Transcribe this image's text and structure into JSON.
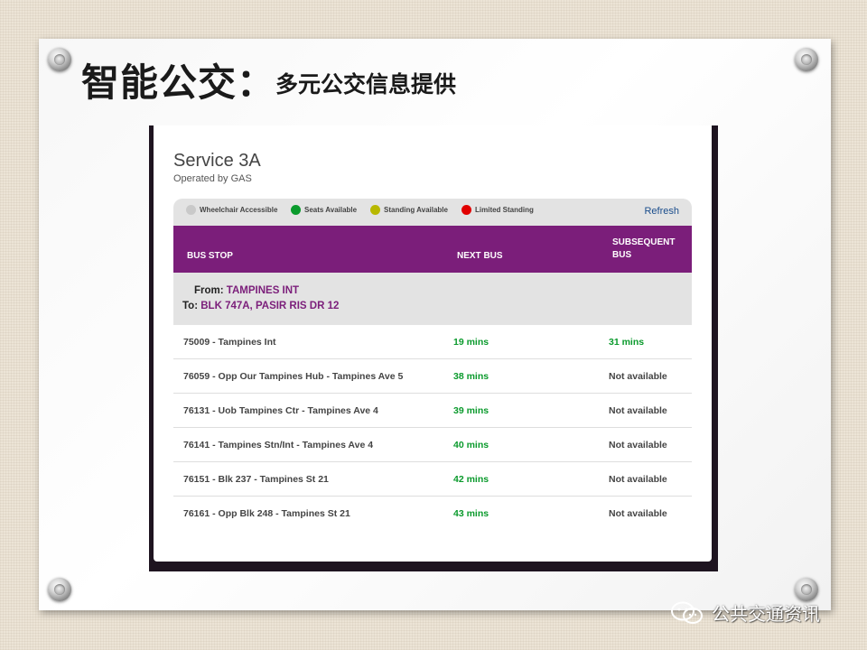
{
  "slide": {
    "title_main": "智能公交：",
    "title_sub": "多元公交信息提供"
  },
  "service": {
    "title": "Service 3A",
    "operator": "Operated by GAS"
  },
  "legend": {
    "items": [
      {
        "label": "Wheelchair Accessible",
        "color": "#c9c9c9"
      },
      {
        "label": "Seats Available",
        "color": "#0a9a2c"
      },
      {
        "label": "Standing Available",
        "color": "#b8b800"
      },
      {
        "label": "Limited Standing",
        "color": "#e10000"
      }
    ],
    "refresh_label": "Refresh"
  },
  "table": {
    "headers": {
      "bus_stop": "BUS STOP",
      "next_bus": "NEXT BUS",
      "subsequent_1": "SUBSEQUENT",
      "subsequent_2": "BUS"
    },
    "route": {
      "from_label": "From:",
      "from_value": "TAMPINES INT",
      "to_label": "To:",
      "to_value": "BLK 747A, PASIR RIS DR 12"
    },
    "rows": [
      {
        "stop": "75009 - Tampines Int",
        "next": "19 mins",
        "subsequent": "31 mins"
      },
      {
        "stop": "76059 - Opp Our Tampines Hub - Tampines Ave 5",
        "next": "38 mins",
        "subsequent": "Not available"
      },
      {
        "stop": "76131 - Uob Tampines Ctr - Tampines Ave 4",
        "next": "39 mins",
        "subsequent": "Not available"
      },
      {
        "stop": "76141 - Tampines Stn/Int - Tampines Ave 4",
        "next": "40 mins",
        "subsequent": "Not available"
      },
      {
        "stop": "76151 - Blk 237 - Tampines St 21",
        "next": "42 mins",
        "subsequent": "Not available"
      },
      {
        "stop": "76161 - Opp Blk 248 - Tampines St 21",
        "next": "43 mins",
        "subsequent": "Not available"
      }
    ]
  },
  "watermark": {
    "text": "公共交通资讯",
    "icon": "wechat-icon"
  },
  "colors": {
    "header_purple": "#7b1e7a",
    "time_green": "#0a9a2c",
    "refresh_blue": "#1a4d8c"
  }
}
